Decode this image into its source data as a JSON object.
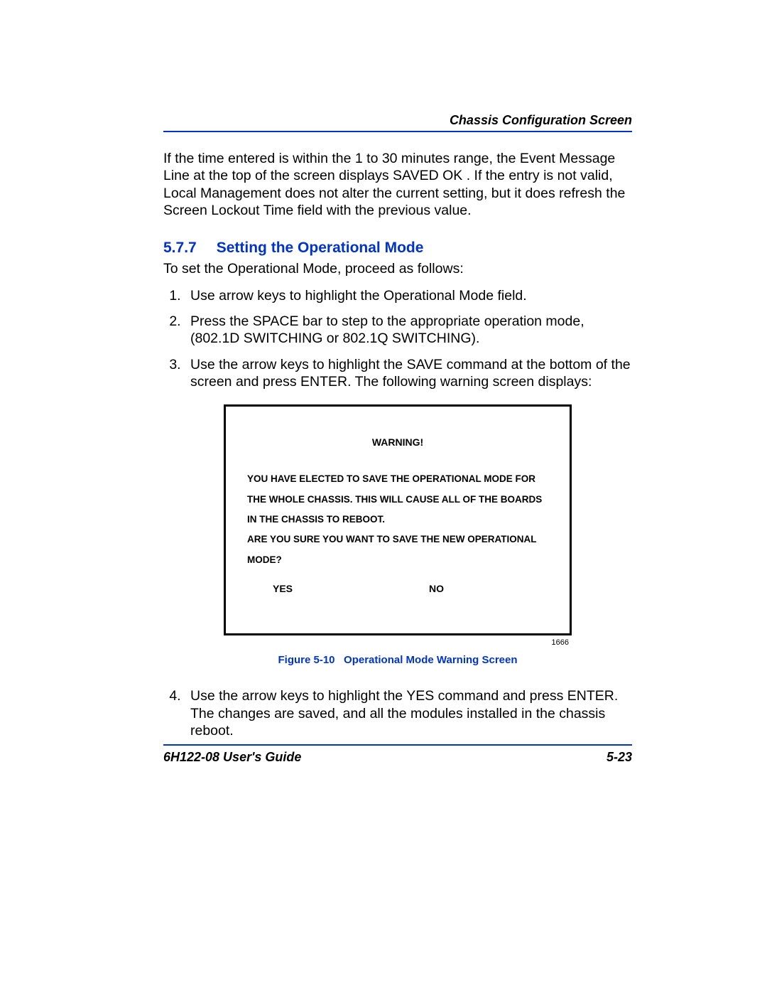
{
  "header": {
    "title": "Chassis Configuration Screen"
  },
  "intro": "If the time entered is within the 1 to 30 minutes range, the Event Message Line at the top of the screen displays  SAVED OK . If the entry is not valid, Local Management does not alter the current setting, but it does refresh the Screen Lockout Time ﬁeld with the previous value.",
  "section": {
    "number": "5.7.7",
    "title": "Setting the Operational Mode",
    "intro": "To set the Operational Mode, proceed as follows:",
    "steps": [
      "Use arrow keys to highlight the Operational Mode  field.",
      "Press the SPACE bar to step to the appropriate operation mode, (802.1D SWITCHING or 802.1Q SWITCHING).",
      "Use the arrow keys to highlight the SAVE command at the bottom of the screen and press ENTER. The following warning screen displays:"
    ],
    "steps_continue": [
      "Use the arrow keys to highlight the YES command and press ENTER. The changes are saved, and all the modules installed in the chassis reboot."
    ]
  },
  "warning": {
    "heading": "WARNING!",
    "body": "YOU HAVE ELECTED TO SAVE THE OPERATIONAL MODE FOR THE WHOLE CHASSIS. THIS WILL CAUSE ALL OF THE BOARDS IN THE CHASSIS TO REBOOT.",
    "question": "ARE YOU SURE YOU WANT TO SAVE THE NEW OPERATIONAL MODE?",
    "yes": "YES",
    "no": "NO",
    "figure_id_small": "1666"
  },
  "figure_caption": {
    "label": "Figure 5-10",
    "text": "Operational Mode Warning Screen"
  },
  "footer": {
    "left": "6H122-08 User's Guide",
    "right": "5-23"
  }
}
